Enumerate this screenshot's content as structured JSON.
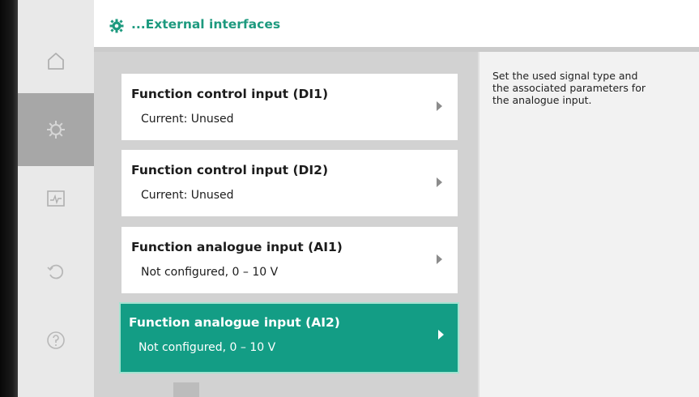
{
  "header": {
    "title": "...External interfaces",
    "icon": "gear-icon",
    "accent_color": "#1d9a7f"
  },
  "rail": {
    "items": [
      {
        "name": "home",
        "icon": "home-icon"
      },
      {
        "name": "settings",
        "icon": "gear-icon",
        "active": true
      },
      {
        "name": "diagnostics",
        "icon": "diagnostics-icon"
      },
      {
        "name": "restore",
        "icon": "restore-icon"
      },
      {
        "name": "help",
        "icon": "help-icon"
      }
    ]
  },
  "menu": {
    "items": [
      {
        "title": "Function control input (DI1)",
        "subtitle": "Current: Unused"
      },
      {
        "title": "Function control input (DI2)",
        "subtitle": "Current: Unused"
      },
      {
        "title": "Function analogue input (AI1)",
        "subtitle": "Not configured, 0 – 10 V"
      },
      {
        "title": "Function analogue input (AI2)",
        "subtitle": "Not configured, 0 – 10 V",
        "selected": true
      }
    ],
    "selected_color": "#139d85"
  },
  "help": {
    "text": "Set the used signal type and the associated parameters for the analogue input."
  }
}
